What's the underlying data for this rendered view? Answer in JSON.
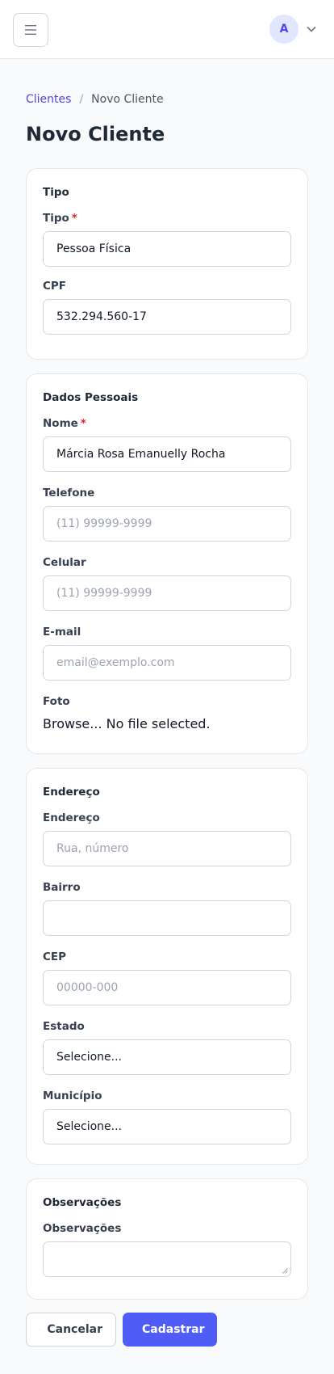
{
  "header": {
    "menu_icon": "hamburger-menu-icon",
    "avatar_initial": "A",
    "avatar_chevron_icon": "chevron-down-icon"
  },
  "breadcrumb": {
    "parent": "Clientes",
    "separator": "/",
    "current": "Novo Cliente"
  },
  "page_title": "Novo Cliente",
  "tipo_section": {
    "title": "Tipo",
    "tipo_label": "Tipo",
    "tipo_required": "*",
    "tipo_value": "Pessoa Física",
    "cpf_label": "CPF",
    "cpf_value": "532.294.560-17"
  },
  "dados_section": {
    "title": "Dados Pessoais",
    "nome_label": "Nome",
    "nome_required": "*",
    "nome_value": "Márcia Rosa Emanuelly Rocha",
    "telefone_label": "Telefone",
    "telefone_placeholder": "(11) 99999-9999",
    "celular_label": "Celular",
    "celular_placeholder": "(11) 99999-9999",
    "email_label": "E-mail",
    "email_placeholder": "email@exemplo.com",
    "foto_label": "Foto",
    "foto_button": "Browse...",
    "foto_status": "No file selected."
  },
  "endereco_section": {
    "title": "Endereço",
    "endereco_label": "Endereço",
    "endereco_placeholder": "Rua, número",
    "bairro_label": "Bairro",
    "bairro_value": "",
    "cep_label": "CEP",
    "cep_placeholder": "00000-000",
    "estado_label": "Estado",
    "estado_value": "Selecione...",
    "municipio_label": "Município",
    "municipio_value": "Selecione..."
  },
  "observacoes_section": {
    "title": "Observações",
    "observacoes_label": "Observações",
    "observacoes_value": ""
  },
  "actions": {
    "cancel_label": "Cancelar",
    "cancel_icon": "arrow-left-icon",
    "submit_label": "Cadastrar",
    "submit_icon": "check-icon"
  },
  "colors": {
    "accent": "#4f5cf5",
    "link": "#4f46e5",
    "required": "#dc2626"
  }
}
